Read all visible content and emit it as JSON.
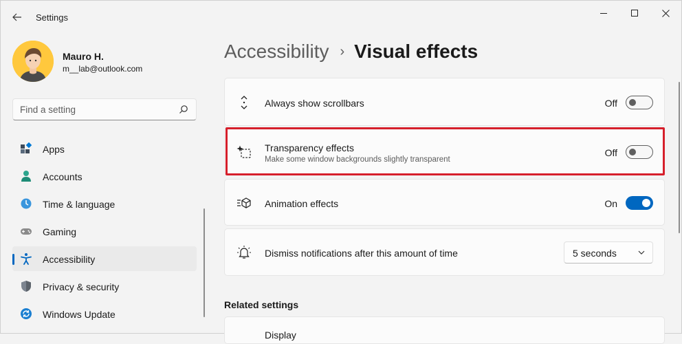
{
  "window": {
    "title": "Settings"
  },
  "user": {
    "name": "Mauro H.",
    "email": "m__lab@outlook.com"
  },
  "search": {
    "placeholder": "Find a setting"
  },
  "sidebar": {
    "items": [
      {
        "label": "Apps",
        "icon": "apps-icon",
        "selected": false
      },
      {
        "label": "Accounts",
        "icon": "accounts-icon",
        "selected": false
      },
      {
        "label": "Time & language",
        "icon": "time-language-icon",
        "selected": false
      },
      {
        "label": "Gaming",
        "icon": "gaming-icon",
        "selected": false
      },
      {
        "label": "Accessibility",
        "icon": "accessibility-icon",
        "selected": true
      },
      {
        "label": "Privacy & security",
        "icon": "privacy-shield-icon",
        "selected": false
      },
      {
        "label": "Windows Update",
        "icon": "windows-update-icon",
        "selected": false
      }
    ]
  },
  "breadcrumb": {
    "parent": "Accessibility",
    "separator": "›",
    "current": "Visual effects"
  },
  "settings": [
    {
      "title": "Always show scrollbars",
      "state": "Off",
      "on": false,
      "icon": "scrollbars-icon"
    },
    {
      "title": "Transparency effects",
      "description": "Make some window backgrounds slightly transparent",
      "state": "Off",
      "on": false,
      "icon": "transparency-icon"
    },
    {
      "title": "Animation effects",
      "state": "On",
      "on": true,
      "icon": "animation-icon"
    },
    {
      "title": "Dismiss notifications after this amount of time",
      "value": "5 seconds",
      "icon": "notification-bell-icon"
    }
  ],
  "related": {
    "title": "Related settings",
    "first_item": "Display"
  },
  "colors": {
    "accent": "#0067c0",
    "highlight": "#d61f2b",
    "avatar_bg": "#ffc83d"
  }
}
